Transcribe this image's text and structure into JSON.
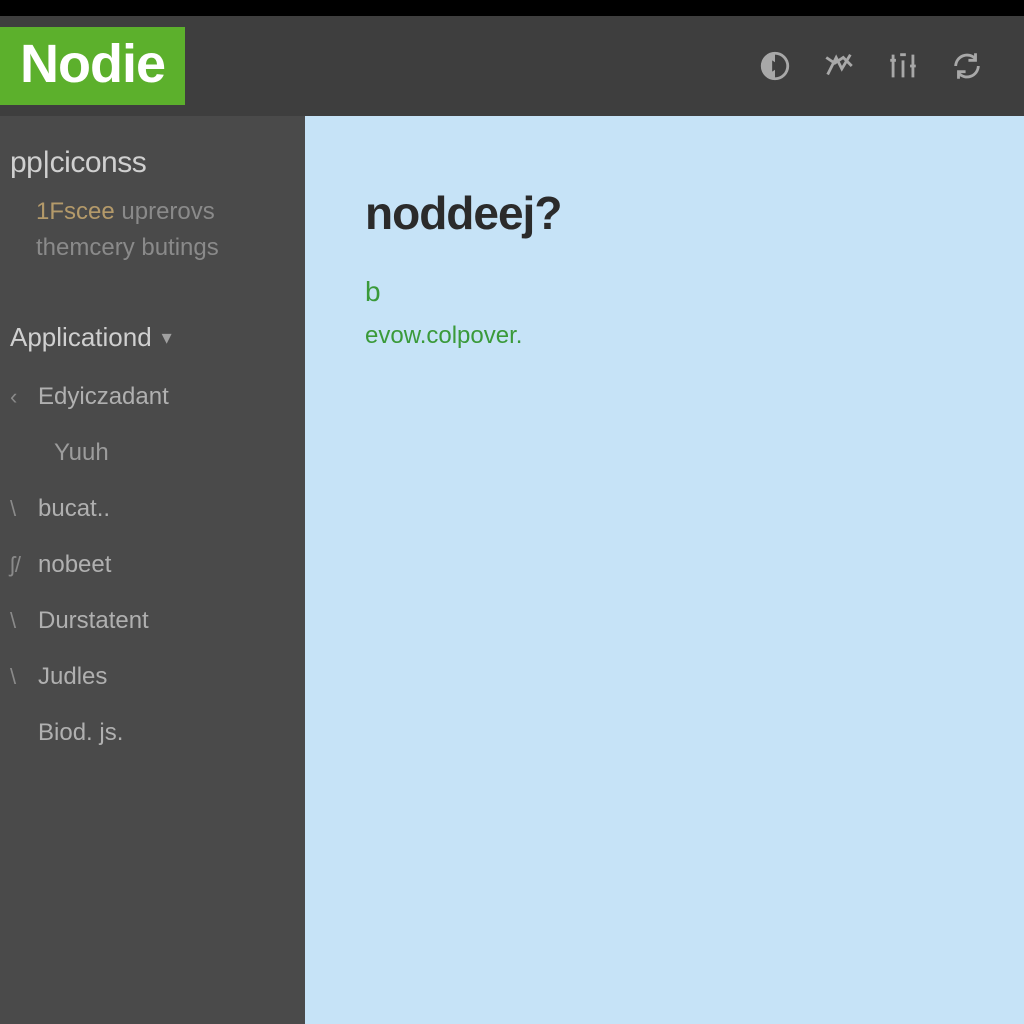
{
  "header": {
    "logo": "Nodie",
    "icons": [
      "play-icon",
      "settings-icon",
      "tools-icon",
      "sync-icon"
    ]
  },
  "sidebar": {
    "section1_title": "pp|ciconss",
    "section1_items": [
      {
        "prefix": "1Fscee",
        "text": "uprerovs"
      },
      {
        "prefix": "",
        "text": "themcery butings"
      }
    ],
    "dropdown_label": "Applicationd",
    "nav": [
      {
        "marker": "‹",
        "label": "Edyiczadant"
      },
      {
        "marker": "",
        "label": "Yuuh"
      },
      {
        "marker": "\\",
        "label": "bucat.."
      },
      {
        "marker": "ʃ/",
        "label": "nobeet"
      },
      {
        "marker": "\\",
        "label": "Durstatent"
      },
      {
        "marker": "\\",
        "label": "Judles"
      },
      {
        "marker": "",
        "label": "Biod. js."
      }
    ]
  },
  "main": {
    "heading": "noddeej?",
    "line1": "b",
    "line2": "evow.colpover."
  }
}
